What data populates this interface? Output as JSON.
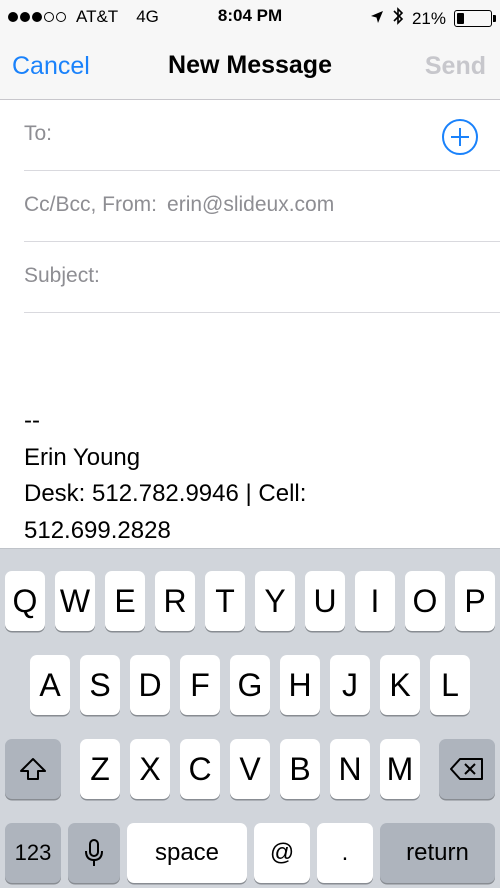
{
  "status_bar": {
    "carrier": "AT&T",
    "network": "4G",
    "signal_bars": 3,
    "time": "8:04 PM",
    "battery_percent": "21%",
    "battery_level": 0.21,
    "icons": [
      "location-arrow-icon",
      "bluetooth-icon",
      "battery-icon"
    ]
  },
  "nav": {
    "cancel_label": "Cancel",
    "title": "New Message",
    "send_label": "Send",
    "accent_color": "#1a82fb",
    "disabled_color": "#c7c7cc"
  },
  "fields": {
    "to_label": "To:",
    "cc_label": "Cc/Bcc, From:",
    "from_value": "erin@slideux.com",
    "subject_label": "Subject:",
    "add_icon": "add-contact-icon"
  },
  "body": {
    "lines": [
      "--",
      "Erin Young",
      "Desk: 512.782.9946  |  Cell:",
      "512.699.2828"
    ]
  },
  "keyboard": {
    "row1": [
      "Q",
      "W",
      "E",
      "R",
      "T",
      "Y",
      "U",
      "I",
      "O",
      "P"
    ],
    "row2": [
      "A",
      "S",
      "D",
      "F",
      "G",
      "H",
      "J",
      "K",
      "L"
    ],
    "row3": [
      "Z",
      "X",
      "C",
      "V",
      "B",
      "N",
      "M"
    ],
    "shift_icon": "shift-icon",
    "delete_icon": "delete-icon",
    "numbers_label": "123",
    "mic_icon": "microphone-icon",
    "space_label": "space",
    "at_label": "@",
    "dot_label": ".",
    "return_label": "return"
  }
}
